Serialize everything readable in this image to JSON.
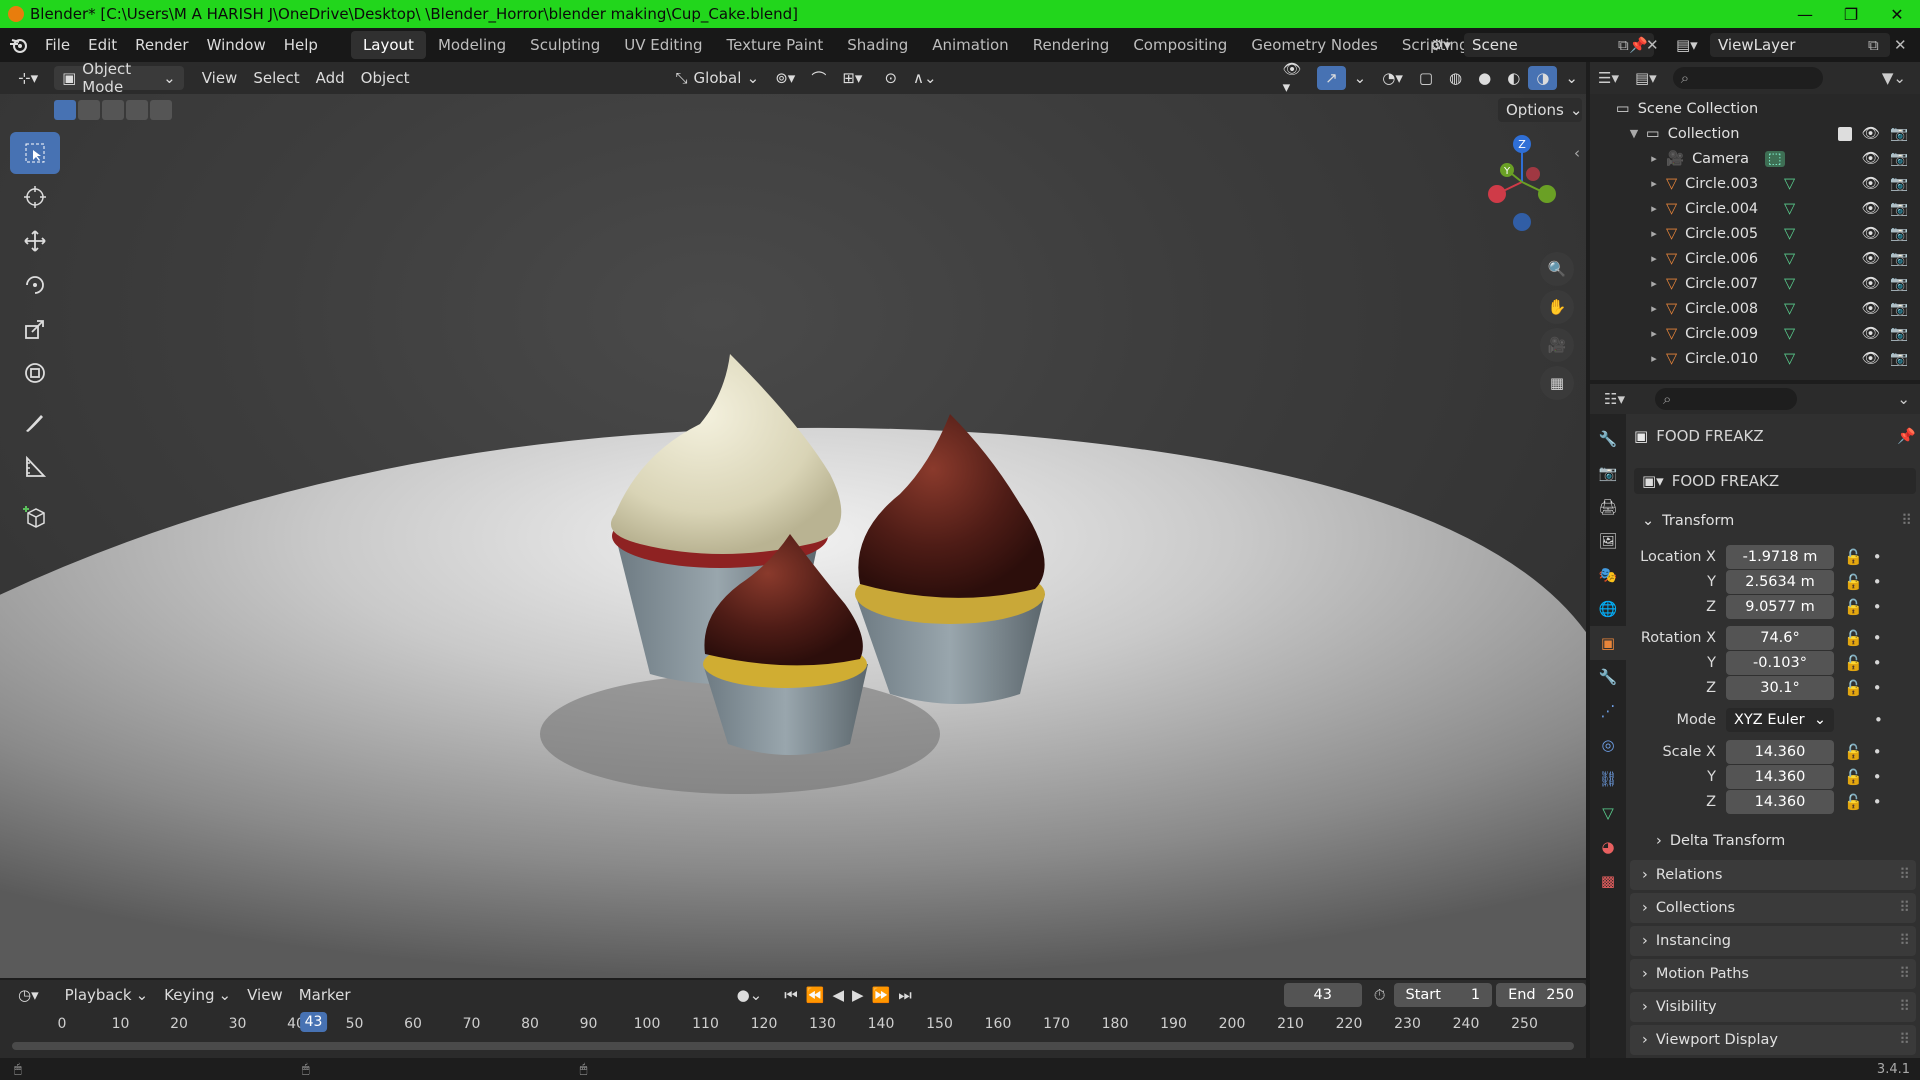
{
  "titlebar": {
    "title": "Blender* [C:\\Users\\M A HARISH J\\OneDrive\\Desktop\\ \\Blender_Horror\\blender making\\Cup_Cake.blend]",
    "minimize": "—",
    "maximize": "❐",
    "close": "✕"
  },
  "menu": {
    "file": "File",
    "edit": "Edit",
    "render": "Render",
    "window": "Window",
    "help": "Help"
  },
  "workspaces": [
    "Layout",
    "Modeling",
    "Sculpting",
    "UV Editing",
    "Texture Paint",
    "Shading",
    "Animation",
    "Rendering",
    "Compositing",
    "Geometry Nodes",
    "Scripting"
  ],
  "active_workspace": "Layout",
  "scene": {
    "name": "Scene",
    "view_layer": "ViewLayer"
  },
  "header3d": {
    "mode": "Object Mode",
    "view": "View",
    "select": "Select",
    "add": "Add",
    "object": "Object",
    "orientation": "Global",
    "options": "Options"
  },
  "gizmo": {
    "z": "Z",
    "y": "Y"
  },
  "outliner": {
    "scene_collection": "Scene Collection",
    "collection": "Collection",
    "items": [
      "Camera",
      "Circle.003",
      "Circle.004",
      "Circle.005",
      "Circle.006",
      "Circle.007",
      "Circle.008",
      "Circle.009",
      "Circle.010"
    ]
  },
  "properties": {
    "object_name": "FOOD FREAKZ",
    "data_name": "FOOD FREAKZ",
    "transform_label": "Transform",
    "location": {
      "label": "Location X",
      "x": "-1.9718 m",
      "y": "2.5634 m",
      "z": "9.0577 m"
    },
    "rotation": {
      "label": "Rotation X",
      "x": "74.6°",
      "y": "-0.103°",
      "z": "30.1°"
    },
    "mode": {
      "label": "Mode",
      "value": "XYZ Euler"
    },
    "scale": {
      "label": "Scale X",
      "x": "14.360",
      "y": "14.360",
      "z": "14.360"
    },
    "y_label": "Y",
    "z_label": "Z",
    "sections": [
      "Delta Transform",
      "Relations",
      "Collections",
      "Instancing",
      "Motion Paths",
      "Visibility",
      "Viewport Display"
    ]
  },
  "timeline": {
    "playback": "Playback",
    "keying": "Keying",
    "view": "View",
    "marker": "Marker",
    "current_frame": "43",
    "start_label": "Start",
    "start": "1",
    "end_label": "End",
    "end": "250",
    "ticks": [
      "0",
      "10",
      "20",
      "30",
      "40",
      "50",
      "60",
      "70",
      "80",
      "90",
      "100",
      "110",
      "120",
      "130",
      "140",
      "150",
      "160",
      "170",
      "180",
      "190",
      "200",
      "210",
      "220",
      "230",
      "240",
      "250"
    ],
    "current_frame_marker": 43
  },
  "status": {
    "version": "3.4.1"
  },
  "colors": {
    "titlebar": "#22d61c",
    "accent": "#4772b3",
    "orange": "#e8853a"
  }
}
